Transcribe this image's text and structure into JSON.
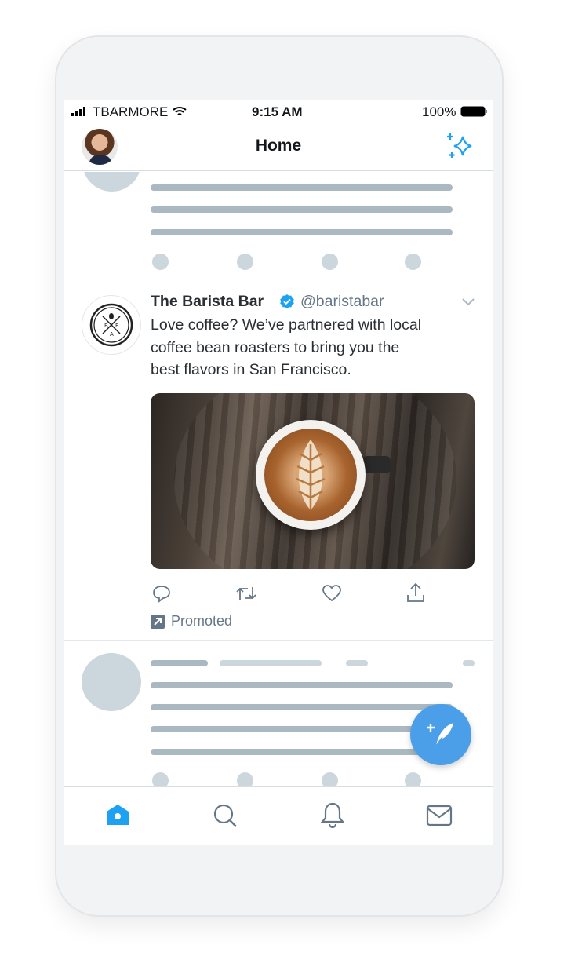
{
  "status_bar": {
    "carrier": "TBARMORE",
    "time": "9:15 AM",
    "battery": "100%"
  },
  "header": {
    "title": "Home",
    "left_icon": "avatar",
    "right_icon": "sparkle-icon"
  },
  "tweet": {
    "name": "The Barista Bar",
    "handle": "@baristabar",
    "verified": true,
    "text_lines": [
      "Love coffee? We’ve partnered with local",
      "coffee bean roasters to bring you the",
      "best flavors in San Francisco."
    ],
    "logo_letters": "B R A",
    "promoted_label": "Promoted",
    "actions": [
      "reply-icon",
      "retweet-icon",
      "like-icon",
      "share-icon"
    ]
  },
  "tab_bar": [
    "home-icon",
    "search-icon",
    "notifications-icon",
    "messages-icon"
  ],
  "colors": {
    "accent": "#1da1f2",
    "fab": "#4a9fe8",
    "skeleton": "#aab8c2",
    "muted": "#657786"
  }
}
